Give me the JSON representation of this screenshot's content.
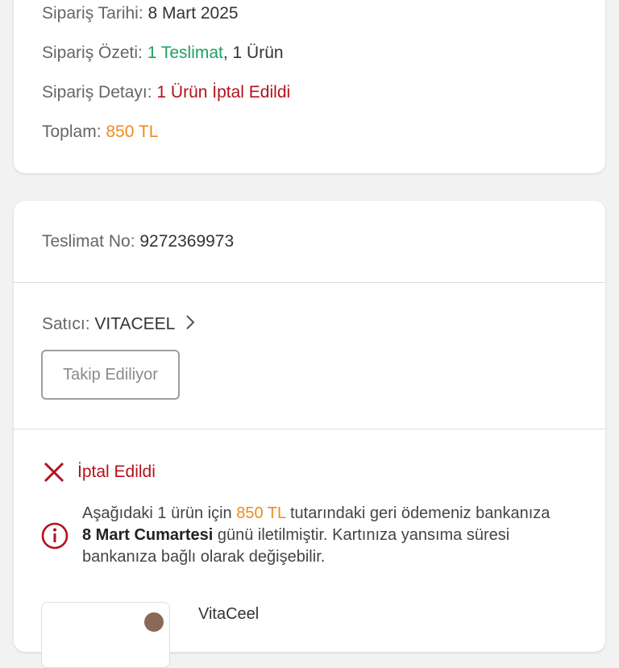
{
  "summary": {
    "date_label": "Sipariş Tarihi:",
    "date_value": "8 Mart 2025",
    "overview_label": "Sipariş Özeti:",
    "overview_deliveries": "1 Teslimat",
    "overview_items": ", 1 Ürün",
    "detail_label": "Sipariş Detayı:",
    "detail_value": "1 Ürün İptal Edildi",
    "total_label": "Toplam:",
    "total_value": "850 TL"
  },
  "delivery": {
    "number_label": "Teslimat No:",
    "number_value": "9272369973",
    "seller_label": "Satıcı:",
    "seller_name": "VITACEEL",
    "follow_button": "Takip Ediliyor",
    "status_label": "İptal Edildi",
    "refund": {
      "part1": "Aşağıdaki 1 ürün için ",
      "amount": "850 TL",
      "part2": " tutarındaki geri ödemeniz bankanıza ",
      "date": "8 Mart Cumartesi",
      "part3": " günü iletilmiştir. Kartınıza yansıma süresi bankanıza bağlı olarak değişebilir."
    },
    "product_brand": "VitaCeel"
  },
  "icons": {
    "seller_chevron": "chevron-right-icon",
    "cancel": "close-icon",
    "info": "info-icon"
  },
  "colors": {
    "green": "#1aa260",
    "red": "#b3121d",
    "orange": "#f08a1c"
  }
}
